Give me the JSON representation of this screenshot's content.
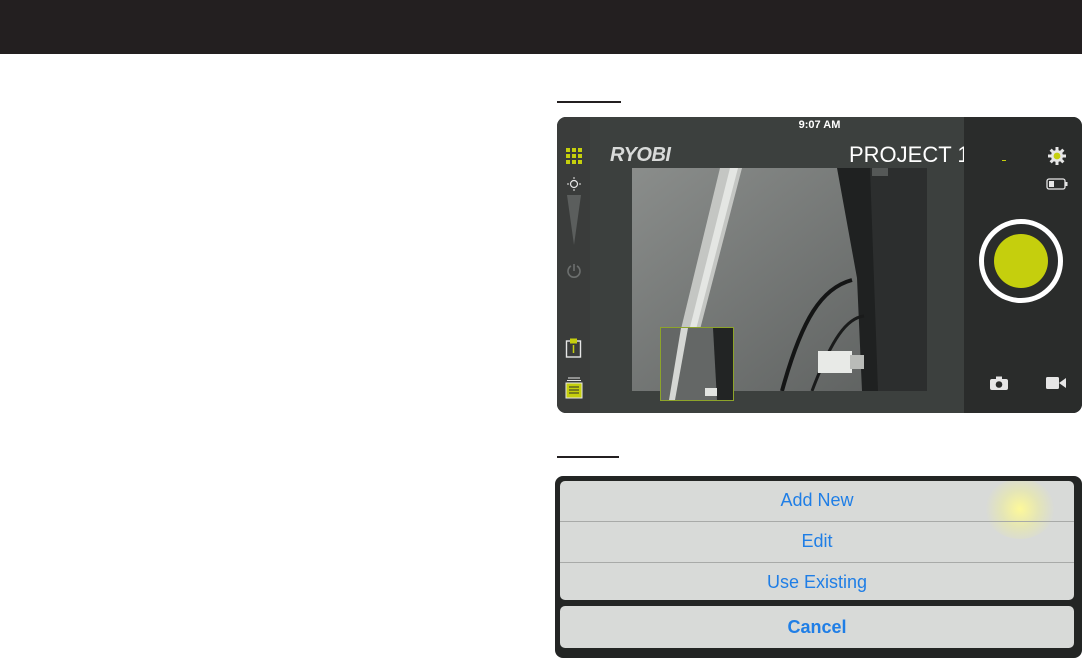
{
  "camera_screen": {
    "status_time": "9:07 AM",
    "brand_logo": "RYOBI",
    "project_title": "PROJECT 1",
    "icons": [
      "grid-menu-icon",
      "brightness-icon",
      "power-icon",
      "clipboard-icon",
      "notes-icon",
      "settings-gear-icon",
      "battery-icon",
      "shutter-button",
      "camera-icon",
      "video-icon"
    ],
    "accent_color": "#c5cf0d"
  },
  "action_sheet": {
    "options": [
      {
        "label": "Add New"
      },
      {
        "label": "Edit"
      },
      {
        "label": "Use Existing"
      }
    ],
    "cancel_label": "Cancel",
    "link_color": "#1f7ee6"
  }
}
